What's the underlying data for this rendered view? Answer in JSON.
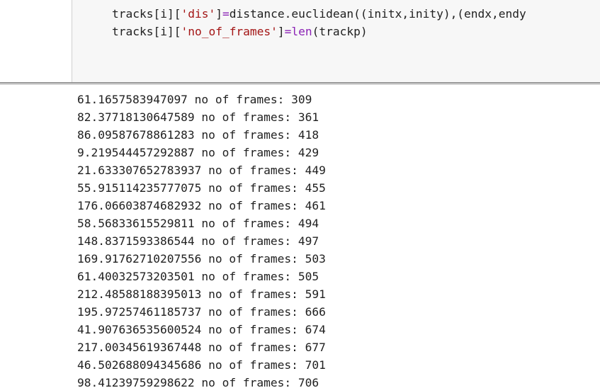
{
  "code_cell": {
    "lines": [
      {
        "parts": [
          {
            "t": "tracks[i][",
            "c": "plain"
          },
          {
            "t": "'dis'",
            "c": "str"
          },
          {
            "t": "]",
            "c": "plain"
          },
          {
            "t": "=",
            "c": "op"
          },
          {
            "t": "distance.euclidean((initx,inity),(endx,endy",
            "c": "plain"
          }
        ]
      },
      {
        "parts": [
          {
            "t": "tracks[i][",
            "c": "plain"
          },
          {
            "t": "'no_of_frames'",
            "c": "str"
          },
          {
            "t": "]",
            "c": "plain"
          },
          {
            "t": "=",
            "c": "op"
          },
          {
            "t": "len",
            "c": "fn"
          },
          {
            "t": "(trackp)",
            "c": "plain"
          }
        ]
      }
    ]
  },
  "output": {
    "lines": [
      "61.1657583947097 no of frames: 309",
      "82.37718130647589 no of frames: 361",
      "86.09587678861283 no of frames: 418",
      "9.219544457292887 no of frames: 429",
      "21.633307652783937 no of frames: 449",
      "55.915114235777075 no of frames: 455",
      "176.06603874682932 no of frames: 461",
      "58.56833615529811 no of frames: 494",
      "148.8371593386544 no of frames: 497",
      "169.91762710207556 no of frames: 503",
      "61.40032573203501 no of frames: 505",
      "212.48588188395013 no of frames: 591",
      "195.97257461185737 no of frames: 666",
      "41.907636535600524 no of frames: 674",
      "217.00345619367448 no of frames: 677",
      "46.502688094345686 no of frames: 701",
      "98.41239759298622 no of frames: 706"
    ]
  }
}
